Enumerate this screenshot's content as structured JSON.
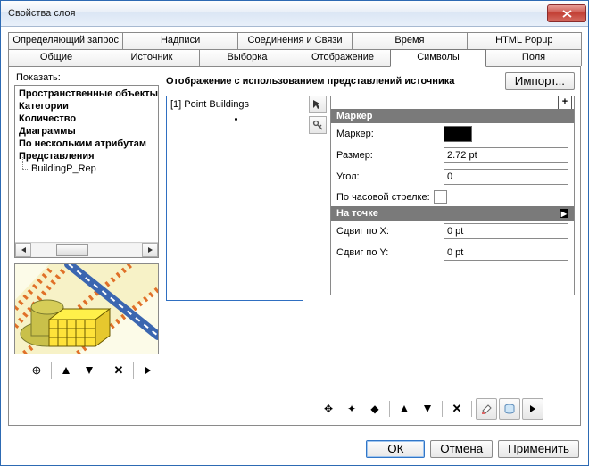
{
  "window": {
    "title": "Свойства слоя"
  },
  "tabs": {
    "row1": [
      "Определяющий запрос",
      "Надписи",
      "Соединения и Связи",
      "Время",
      "HTML Popup"
    ],
    "row2": [
      "Общие",
      "Источник",
      "Выборка",
      "Отображение",
      "Символы",
      "Поля"
    ],
    "active": "Символы"
  },
  "left": {
    "heading": "Показать:",
    "tree": [
      {
        "label": "Пространственные объекты",
        "bold": true
      },
      {
        "label": "Категории",
        "bold": true
      },
      {
        "label": "Количество",
        "bold": true
      },
      {
        "label": "Диаграммы",
        "bold": true
      },
      {
        "label": "По нескольким атрибутам",
        "bold": true
      },
      {
        "label": "Представления",
        "bold": true
      },
      {
        "label": "BuildingP_Rep",
        "bold": false,
        "child": true
      }
    ]
  },
  "right": {
    "headline": "Отображение с использованием представлений источника",
    "import_label": "Импорт...",
    "rule_list_item": "[1] Point Buildings",
    "props": {
      "section_marker": "Маркер",
      "row_marker": "Маркер:",
      "row_size": "Размер:",
      "val_size": "2.72 pt",
      "row_angle": "Угол:",
      "val_angle": "0",
      "row_clockwise": "По часовой стрелке:",
      "section_point": "На точке",
      "row_offx": "Сдвиг по X:",
      "val_offx": "0 pt",
      "row_offy": "Сдвиг по Y:",
      "val_offy": "0 pt"
    }
  },
  "footer": {
    "ok": "ОК",
    "cancel": "Отмена",
    "apply": "Применить"
  }
}
